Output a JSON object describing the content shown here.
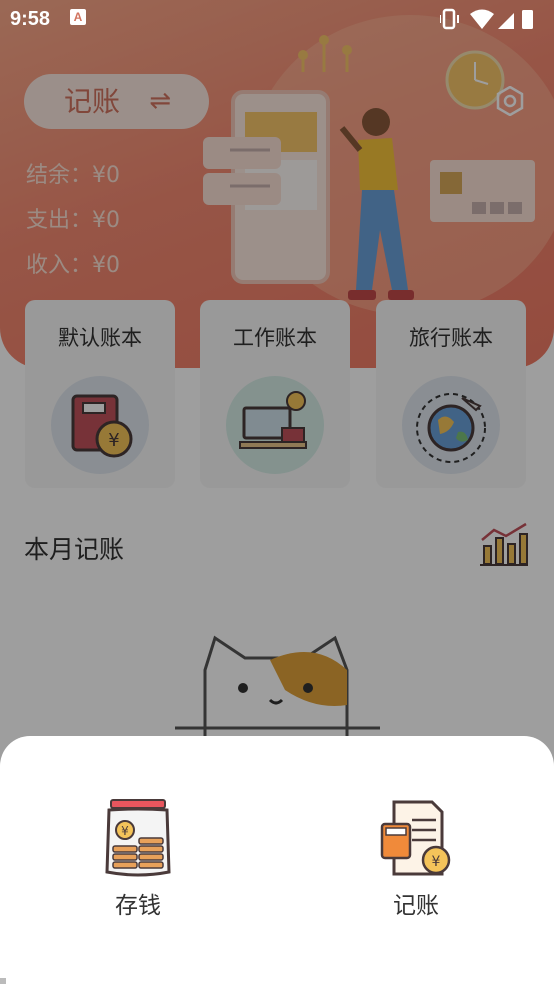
{
  "status_bar": {
    "time": "9:58",
    "notification_letter": "A"
  },
  "header": {
    "mode_button": {
      "label": "记账",
      "swap_symbol": "⇌"
    },
    "summary": {
      "balance": "结余：¥0",
      "expense": "支出：¥0",
      "income": "收入：¥0"
    }
  },
  "account_books": [
    {
      "label": "默认账本",
      "icon": "book-yen-icon"
    },
    {
      "label": "工作账本",
      "icon": "computer-clock-icon"
    },
    {
      "label": "旅行账本",
      "icon": "globe-plane-icon"
    }
  ],
  "monthly": {
    "title": "本月记账",
    "chart_icon": "bar-chart-trend-icon"
  },
  "bottom_sheet": {
    "options": [
      {
        "label": "存钱",
        "icon": "coin-jar-icon"
      },
      {
        "label": "记账",
        "icon": "calculator-document-icon"
      }
    ]
  },
  "colors": {
    "accent": "#ef7a65",
    "accent_text": "#d1735f",
    "overlay": "rgba(0,0,0,0.38)"
  }
}
